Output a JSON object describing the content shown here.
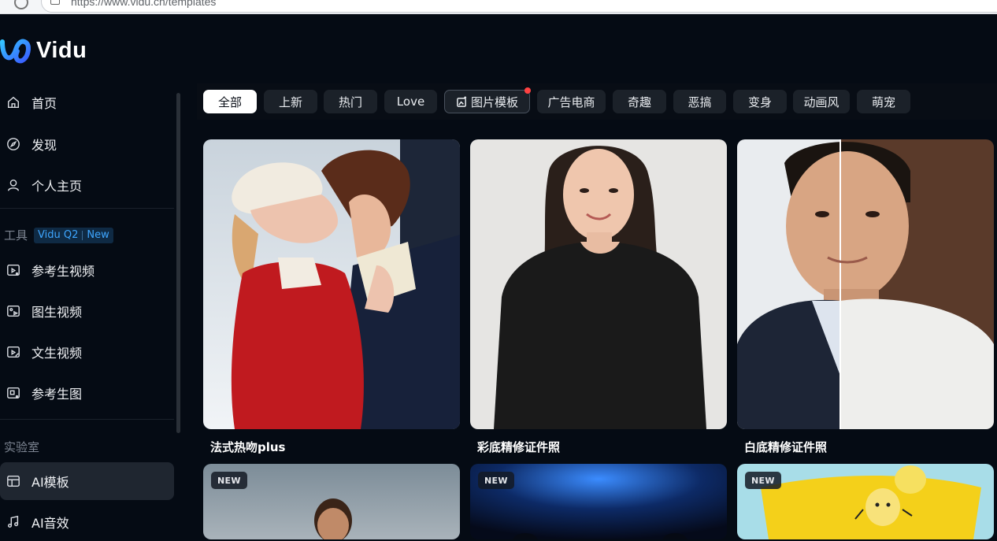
{
  "browser": {
    "url": "https://www.vidu.cn/templates"
  },
  "logo": {
    "name": "Vidu",
    "brand_color": "#3f8cff"
  },
  "sidebar": {
    "main_items": [
      {
        "label": "首页",
        "icon": "home-icon"
      },
      {
        "label": "发现",
        "icon": "compass-icon"
      },
      {
        "label": "个人主页",
        "icon": "user-icon"
      }
    ],
    "tools_section": {
      "label": "工具",
      "badge_model": "Vidu Q2",
      "badge_new": "New"
    },
    "tool_items": [
      {
        "label": "参考生视频",
        "icon": "reference-video-icon"
      },
      {
        "label": "图生视频",
        "icon": "image-to-video-icon"
      },
      {
        "label": "文生视频",
        "icon": "text-to-video-icon"
      },
      {
        "label": "参考生图",
        "icon": "reference-image-icon"
      }
    ],
    "lab_section": {
      "label": "实验室"
    },
    "lab_items": [
      {
        "label": "AI模板",
        "icon": "template-icon",
        "active": true
      },
      {
        "label": "AI音效",
        "icon": "music-note-icon",
        "active": false
      }
    ]
  },
  "tabs": [
    {
      "label": "全部",
      "active": true
    },
    {
      "label": "上新"
    },
    {
      "label": "热门"
    },
    {
      "label": "Love"
    },
    {
      "label": "图片模板",
      "icon": "image-edit-icon",
      "has_dot": true
    },
    {
      "label": "广告电商"
    },
    {
      "label": "奇趣"
    },
    {
      "label": "恶搞"
    },
    {
      "label": "变身"
    },
    {
      "label": "动画风"
    },
    {
      "label": "萌宠"
    }
  ],
  "cards": [
    {
      "title": "法式热吻plus"
    },
    {
      "title": "彩底精修证件照"
    },
    {
      "title": "白底精修证件照"
    }
  ],
  "cards_row2": [
    {
      "badge": "NEW"
    },
    {
      "badge": "NEW"
    },
    {
      "badge": "NEW"
    }
  ],
  "colors": {
    "background": "#050b14",
    "active_tab": "#ffffff",
    "tab_bg": "#1b2129",
    "badge_blue": "#3ea6ff",
    "notification_dot": "#ff4242"
  }
}
